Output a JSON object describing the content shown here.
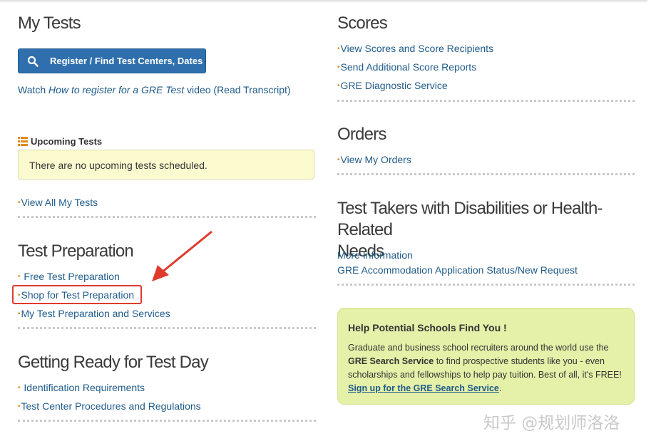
{
  "left": {
    "my_tests": {
      "title": "My Tests",
      "register_button": "Register / Find Test Centers, Dates",
      "watch_prefix": "Watch ",
      "watch_italic": "How to register for a GRE Test",
      "watch_suffix": " video (Read Transcript)"
    },
    "upcoming": {
      "heading": "Upcoming Tests",
      "notice": "There are no upcoming tests scheduled.",
      "view_all": "View All My Tests"
    },
    "test_prep": {
      "title": "Test Preparation",
      "items": [
        "Free Test Preparation",
        "Shop for Test Preparation",
        "My Test Preparation and Services"
      ]
    },
    "test_day": {
      "title": "Getting Ready for Test Day",
      "items": [
        "Identification Requirements",
        "Test Center Procedures and Regulations"
      ]
    }
  },
  "right": {
    "scores": {
      "title": "Scores",
      "items": [
        "View Scores and Score Recipients",
        "Send Additional Score Reports",
        "GRE Diagnostic Service"
      ]
    },
    "orders": {
      "title": "Orders",
      "items": [
        "View My Orders"
      ]
    },
    "disabilities": {
      "title_line1": "Test Takers with Disabilities or Health-Related",
      "title_line2": "Needs",
      "items": [
        "More Information",
        "GRE Accommodation Application Status/New Request"
      ]
    },
    "help": {
      "title": "Help Potential Schools Find You !",
      "body_1": "Graduate and business school recruiters around the world use the",
      "body_bold": "GRE Search Service",
      "body_2": " to find prospective students like you - even scholarships and fellowships to help pay tuition. Best of all, it's FREE! ",
      "signup": "Sign up for the GRE Search Service",
      "body_end": "."
    }
  },
  "watermark": "知乎 @规划师洛洛",
  "colors": {
    "link": "#1f5b8a",
    "bullet": "#e08a1e",
    "button": "#2f6fad",
    "notice_bg": "#fcfbcf",
    "help_bg": "#e5f0a9",
    "highlight": "#e03a2f"
  }
}
